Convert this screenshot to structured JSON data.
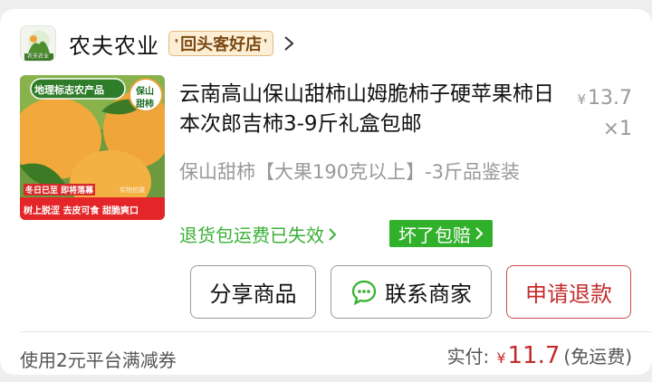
{
  "store": {
    "logo_text": "农夫农业",
    "name": "农夫农业",
    "badge": "回头客好店",
    "chevron_icon": "chevron-right-icon"
  },
  "product": {
    "thumbnail": {
      "top_banner": "地理标志农产品",
      "side_badge": [
        "保山",
        "甜柿"
      ],
      "promo_line1": "冬日已至 即将落幕",
      "promo_line2": "树上脱涩 去皮可食 甜脆爽口",
      "watermark": "实物拍摄"
    },
    "title": "云南高山保山甜柿山姆脆柿子硬苹果柿日本次郎吉柿3-9斤礼盒包邮",
    "price_symbol": "¥",
    "price": "13.7",
    "quantity": "×1",
    "spec": "保山甜柿【大果190克以上】-3斤品鉴装",
    "return_shipping": "退货包运费已失效",
    "broken_guarantee": "坏了包赔"
  },
  "actions": {
    "share": "分享商品",
    "contact": "联系商家",
    "refund": "申请退款"
  },
  "footer": {
    "coupon": "使用2元平台满减券",
    "paid_label": "实付:",
    "paid_symbol": "¥",
    "paid_amount": "11.7",
    "shipping": "(免运费)"
  },
  "colors": {
    "accent_green": "#31b12b",
    "accent_red": "#c42b2b",
    "badge_bg": "#fdeed6"
  }
}
